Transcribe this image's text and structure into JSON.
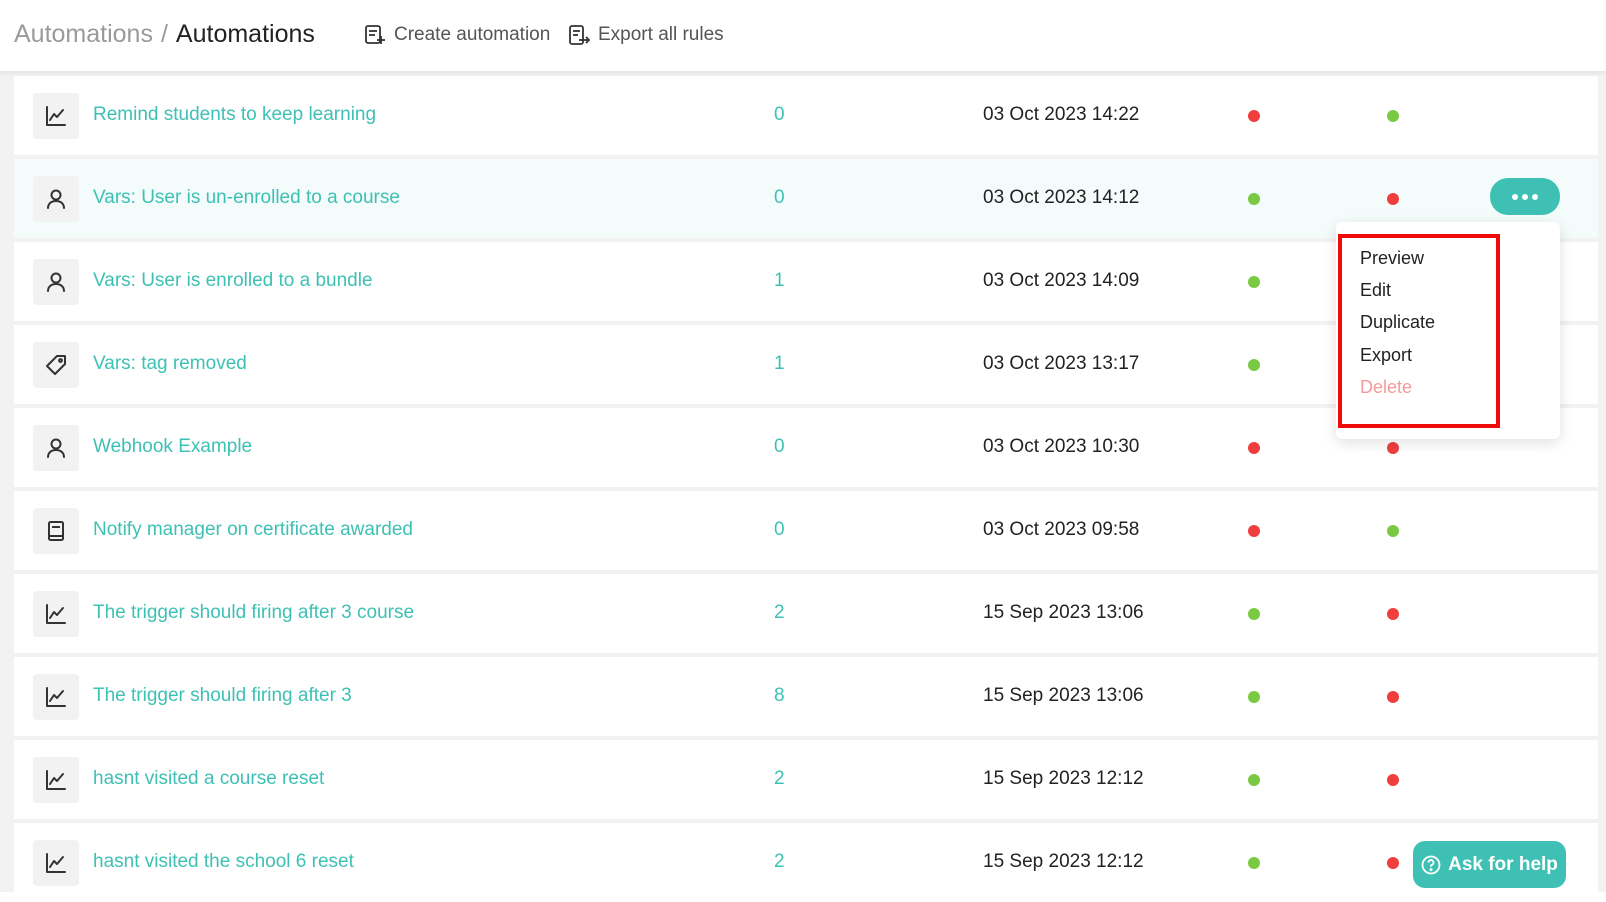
{
  "header": {
    "breadcrumb_parent": "Automations",
    "breadcrumb_separator": "/",
    "breadcrumb_current": "Automations",
    "create_label": "Create automation",
    "export_label": "Export all rules"
  },
  "colors": {
    "accent": "#3ec1b4",
    "status_on": "#7ac943",
    "status_off": "#f03e3e",
    "delete_text": "#f49a9a",
    "callout": "#f00a0a"
  },
  "rows": [
    {
      "icon": "chart-icon",
      "name": "Remind students to keep learning",
      "count": "0",
      "date": "03 Oct 2023 14:22",
      "status1": "red",
      "status2": "green"
    },
    {
      "icon": "user-icon",
      "name": "Vars: User is un-enrolled to a course",
      "count": "0",
      "date": "03 Oct 2023 14:12",
      "status1": "green",
      "status2": "red"
    },
    {
      "icon": "user-icon",
      "name": "Vars: User is enrolled to a bundle",
      "count": "1",
      "date": "03 Oct 2023 14:09",
      "status1": "green",
      "status2": "red"
    },
    {
      "icon": "tag-icon",
      "name": "Vars: tag removed",
      "count": "1",
      "date": "03 Oct 2023 13:17",
      "status1": "green",
      "status2": "red"
    },
    {
      "icon": "user-icon",
      "name": "Webhook Example",
      "count": "0",
      "date": "03 Oct 2023 10:30",
      "status1": "red",
      "status2": "red"
    },
    {
      "icon": "book-icon",
      "name": "Notify manager on certificate awarded",
      "count": "0",
      "date": "03 Oct 2023 09:58",
      "status1": "red",
      "status2": "green"
    },
    {
      "icon": "chart-icon",
      "name": "The trigger should firing after 3 course",
      "count": "2",
      "date": "15 Sep 2023 13:06",
      "status1": "green",
      "status2": "red"
    },
    {
      "icon": "chart-icon",
      "name": "The trigger should firing after 3",
      "count": "8",
      "date": "15 Sep 2023 13:06",
      "status1": "green",
      "status2": "red"
    },
    {
      "icon": "chart-icon",
      "name": "hasnt visited a course reset",
      "count": "2",
      "date": "15 Sep 2023 12:12",
      "status1": "green",
      "status2": "red"
    },
    {
      "icon": "chart-icon",
      "name": "hasnt visited the school 6 reset",
      "count": "2",
      "date": "15 Sep 2023 12:12",
      "status1": "green",
      "status2": "red"
    }
  ],
  "context_menu": {
    "items": [
      "Preview",
      "Edit",
      "Duplicate",
      "Export",
      "Delete"
    ]
  },
  "help": {
    "label": "Ask for help"
  }
}
